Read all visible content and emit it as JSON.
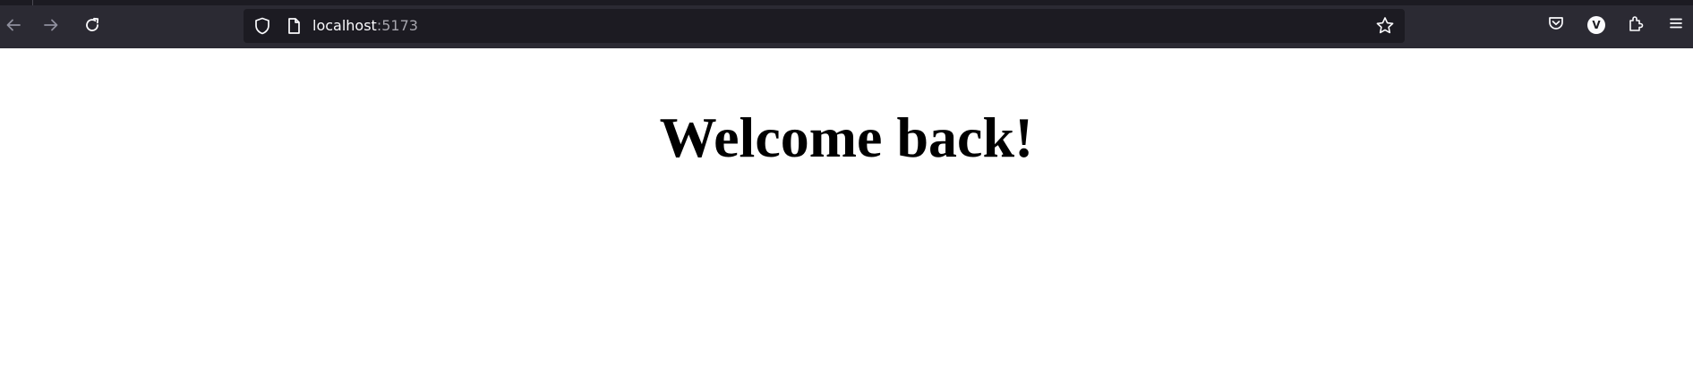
{
  "browser": {
    "url_host": "localhost",
    "url_port": ":5173",
    "profile_initial": "V",
    "icons": {
      "back": "arrow-left-icon",
      "forward": "arrow-right-icon",
      "reload": "reload-icon",
      "tracking_protection": "shield-icon",
      "page_info": "page-icon",
      "bookmark": "star-icon",
      "pocket": "pocket-icon",
      "extensions": "puzzle-icon",
      "menu": "hamburger-menu-icon"
    },
    "colors": {
      "toolbar": "#2b2a33",
      "url_field": "#1c1b22",
      "icon": "#fbfbfe",
      "icon_disabled": "#8f8f9d"
    }
  },
  "page": {
    "heading": "Welcome back!"
  }
}
